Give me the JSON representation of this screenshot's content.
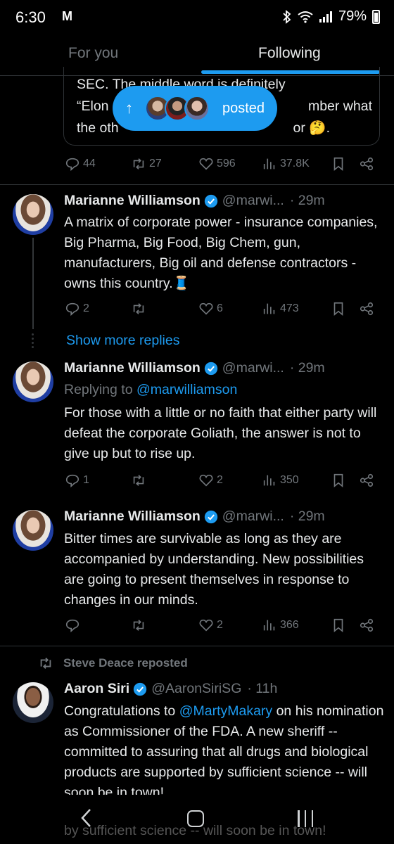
{
  "status_bar": {
    "time": "6:30",
    "carrier_icon": "M",
    "battery": "79%"
  },
  "tabs": {
    "for_you": "For you",
    "following": "Following"
  },
  "quoted_post": {
    "line1": "SEC. The middle word is definitely",
    "line2_start": "“Elon",
    "line2_end": "mber what",
    "line3_start": "the oth",
    "line3_end": "or 🤔."
  },
  "new_posts_pill": {
    "label": "posted"
  },
  "top_actions": {
    "replies": "44",
    "reposts": "27",
    "likes": "596",
    "views": "37.8K"
  },
  "posts": [
    {
      "name": "Marianne Williamson",
      "handle": "@marwi...",
      "time": "· 29m",
      "text": "A matrix of corporate power - insurance companies, Big Pharma, Big Food, Big Chem, gun, manufacturers, Big oil and defense contractors - owns this country.🧵",
      "replies": "2",
      "reposts": "",
      "likes": "6",
      "views": "473"
    },
    {
      "name": "Marianne Williamson",
      "handle": "@marwi...",
      "time": "· 29m",
      "replying_prefix": "Replying to ",
      "replying_to": "@marwilliamson",
      "text": "For those with a little or no faith that either party will defeat the corporate Goliath, the answer is not to give up but to rise up.",
      "replies": "1",
      "reposts": "",
      "likes": "2",
      "views": "350"
    },
    {
      "name": "Marianne Williamson",
      "handle": "@marwi...",
      "time": "· 29m",
      "text": "Bitter times are survivable as long as they are accompanied by understanding. New possibilities are going to present themselves in response to changes in our minds.",
      "replies": "",
      "reposts": "",
      "likes": "2",
      "views": "366"
    }
  ],
  "show_more": "Show more replies",
  "repost_label": "Steve Deace reposted",
  "last_post": {
    "name": "Aaron Siri",
    "handle": "@AaronSiriSG",
    "time": "· 11h",
    "text_before": "Congratulations to ",
    "mention": "@MartyMakary",
    "text_after": " on his nomination as Commissioner of the FDA. A new sheriff -- committed to assuring that all drugs and biological products are supported by sufficient science -- will soon be in town!"
  },
  "nav_ghost_text": "by sufficient science -- will soon be in town!",
  "colors": {
    "accent": "#1d9bf0",
    "muted": "#71767b",
    "text": "#e7e9ea",
    "background": "#000000"
  }
}
